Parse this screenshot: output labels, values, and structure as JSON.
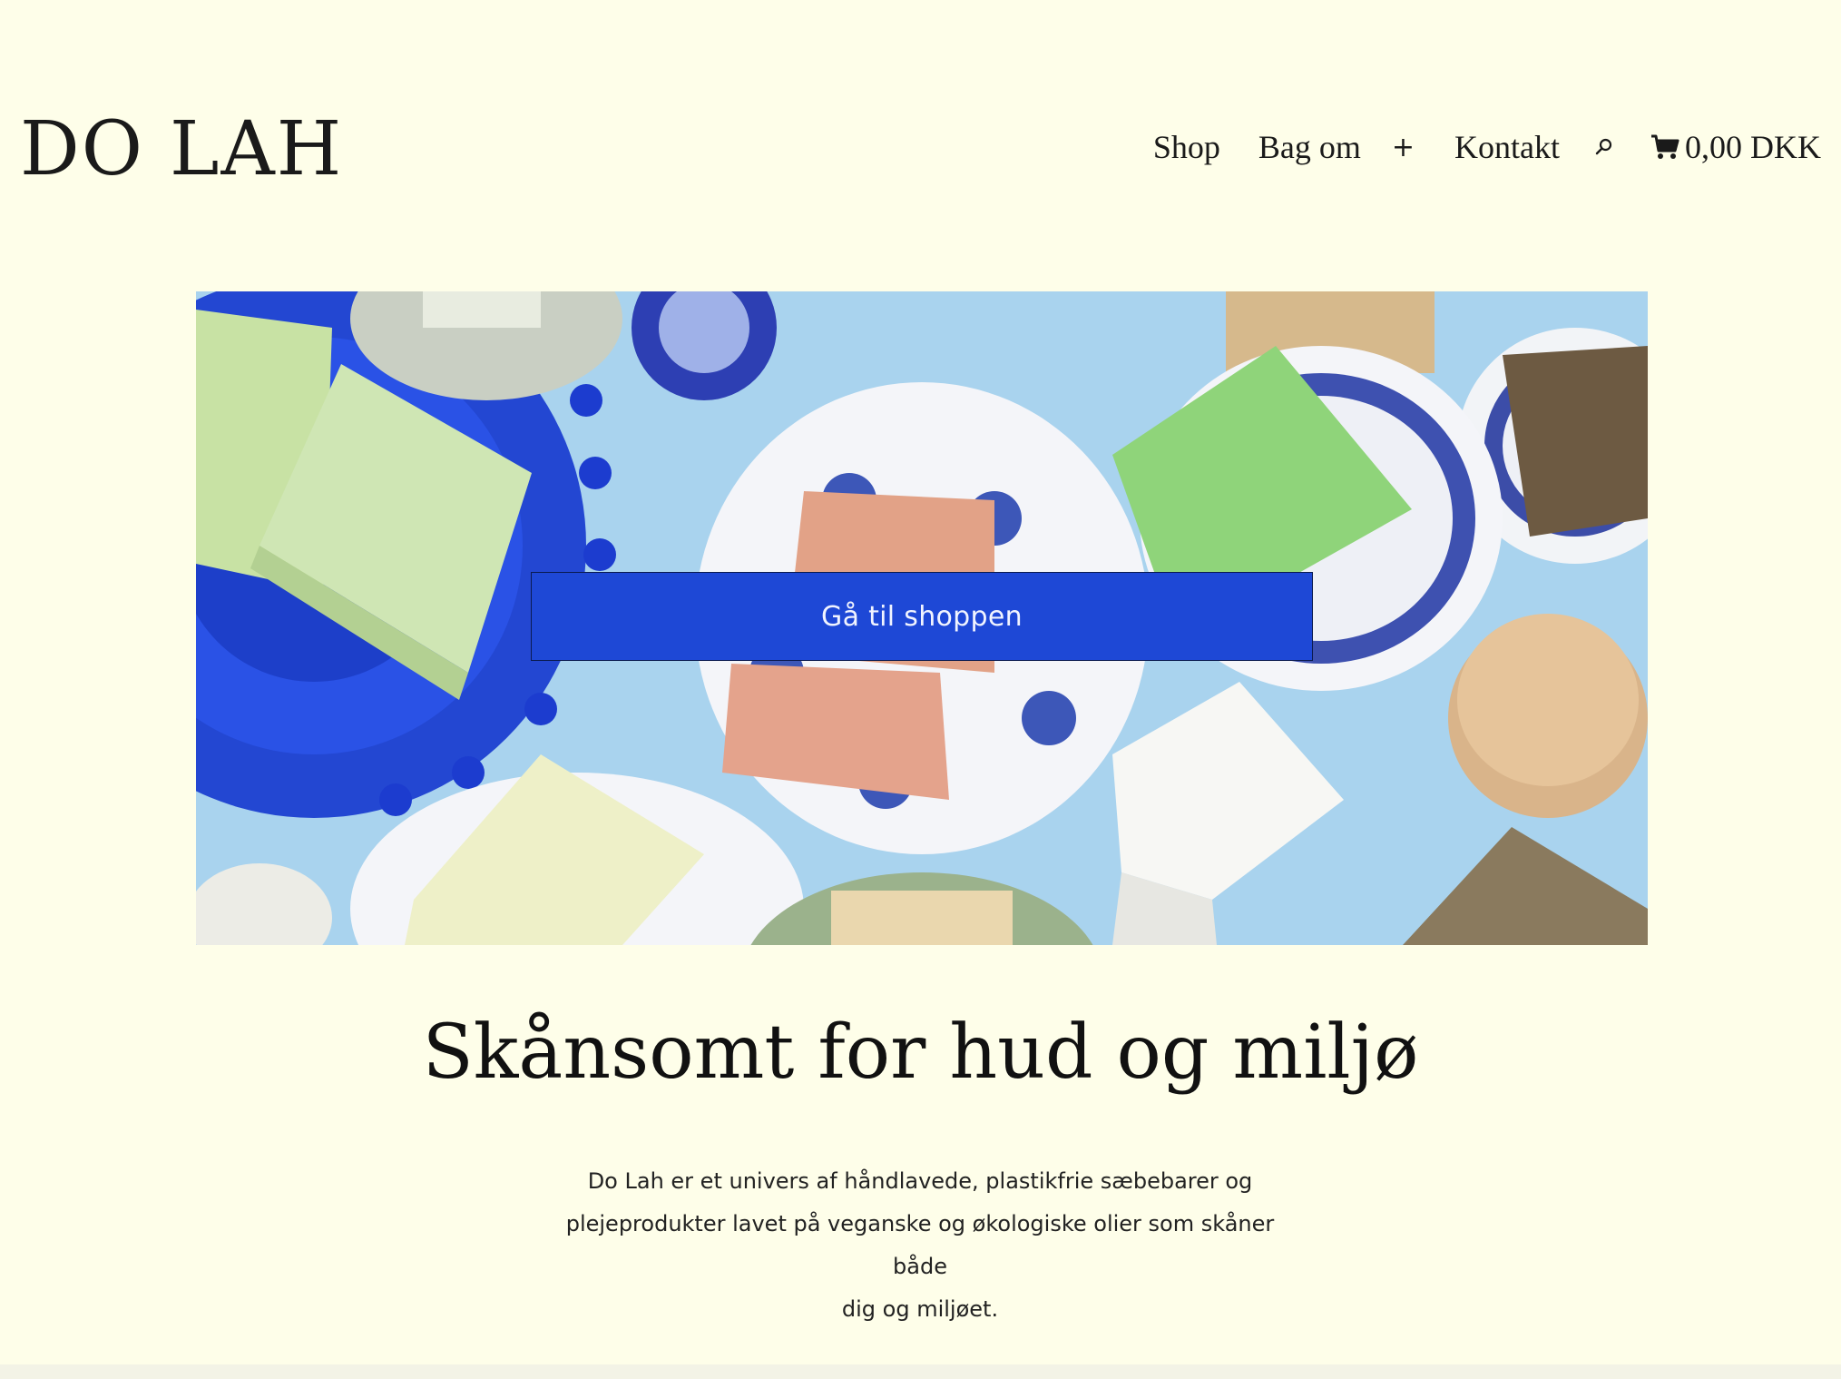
{
  "header": {
    "logo_text": "DO LAH",
    "nav": {
      "shop": "Shop",
      "bag_om": "Bag om",
      "expand_symbol": "+",
      "kontakt": "Kontakt",
      "search_icon": "search-icon",
      "cart_icon": "shopping-cart-icon",
      "cart_total": "0,00 DKK"
    }
  },
  "hero": {
    "cta_label": "Gå til shoppen",
    "background_color": "#a9d3ee",
    "cta_color": "#1e48d6"
  },
  "content": {
    "headline": "Skånsomt for hud og miljø",
    "intro_lines": [
      "Do Lah er et univers af håndlavede, plastikfrie sæbebarer og",
      "plejeprodukter lavet på veganske og økologiske olier som skåner både",
      "dig og miljøet."
    ]
  },
  "colors": {
    "page_background": "#fefee9",
    "text": "#111111"
  }
}
